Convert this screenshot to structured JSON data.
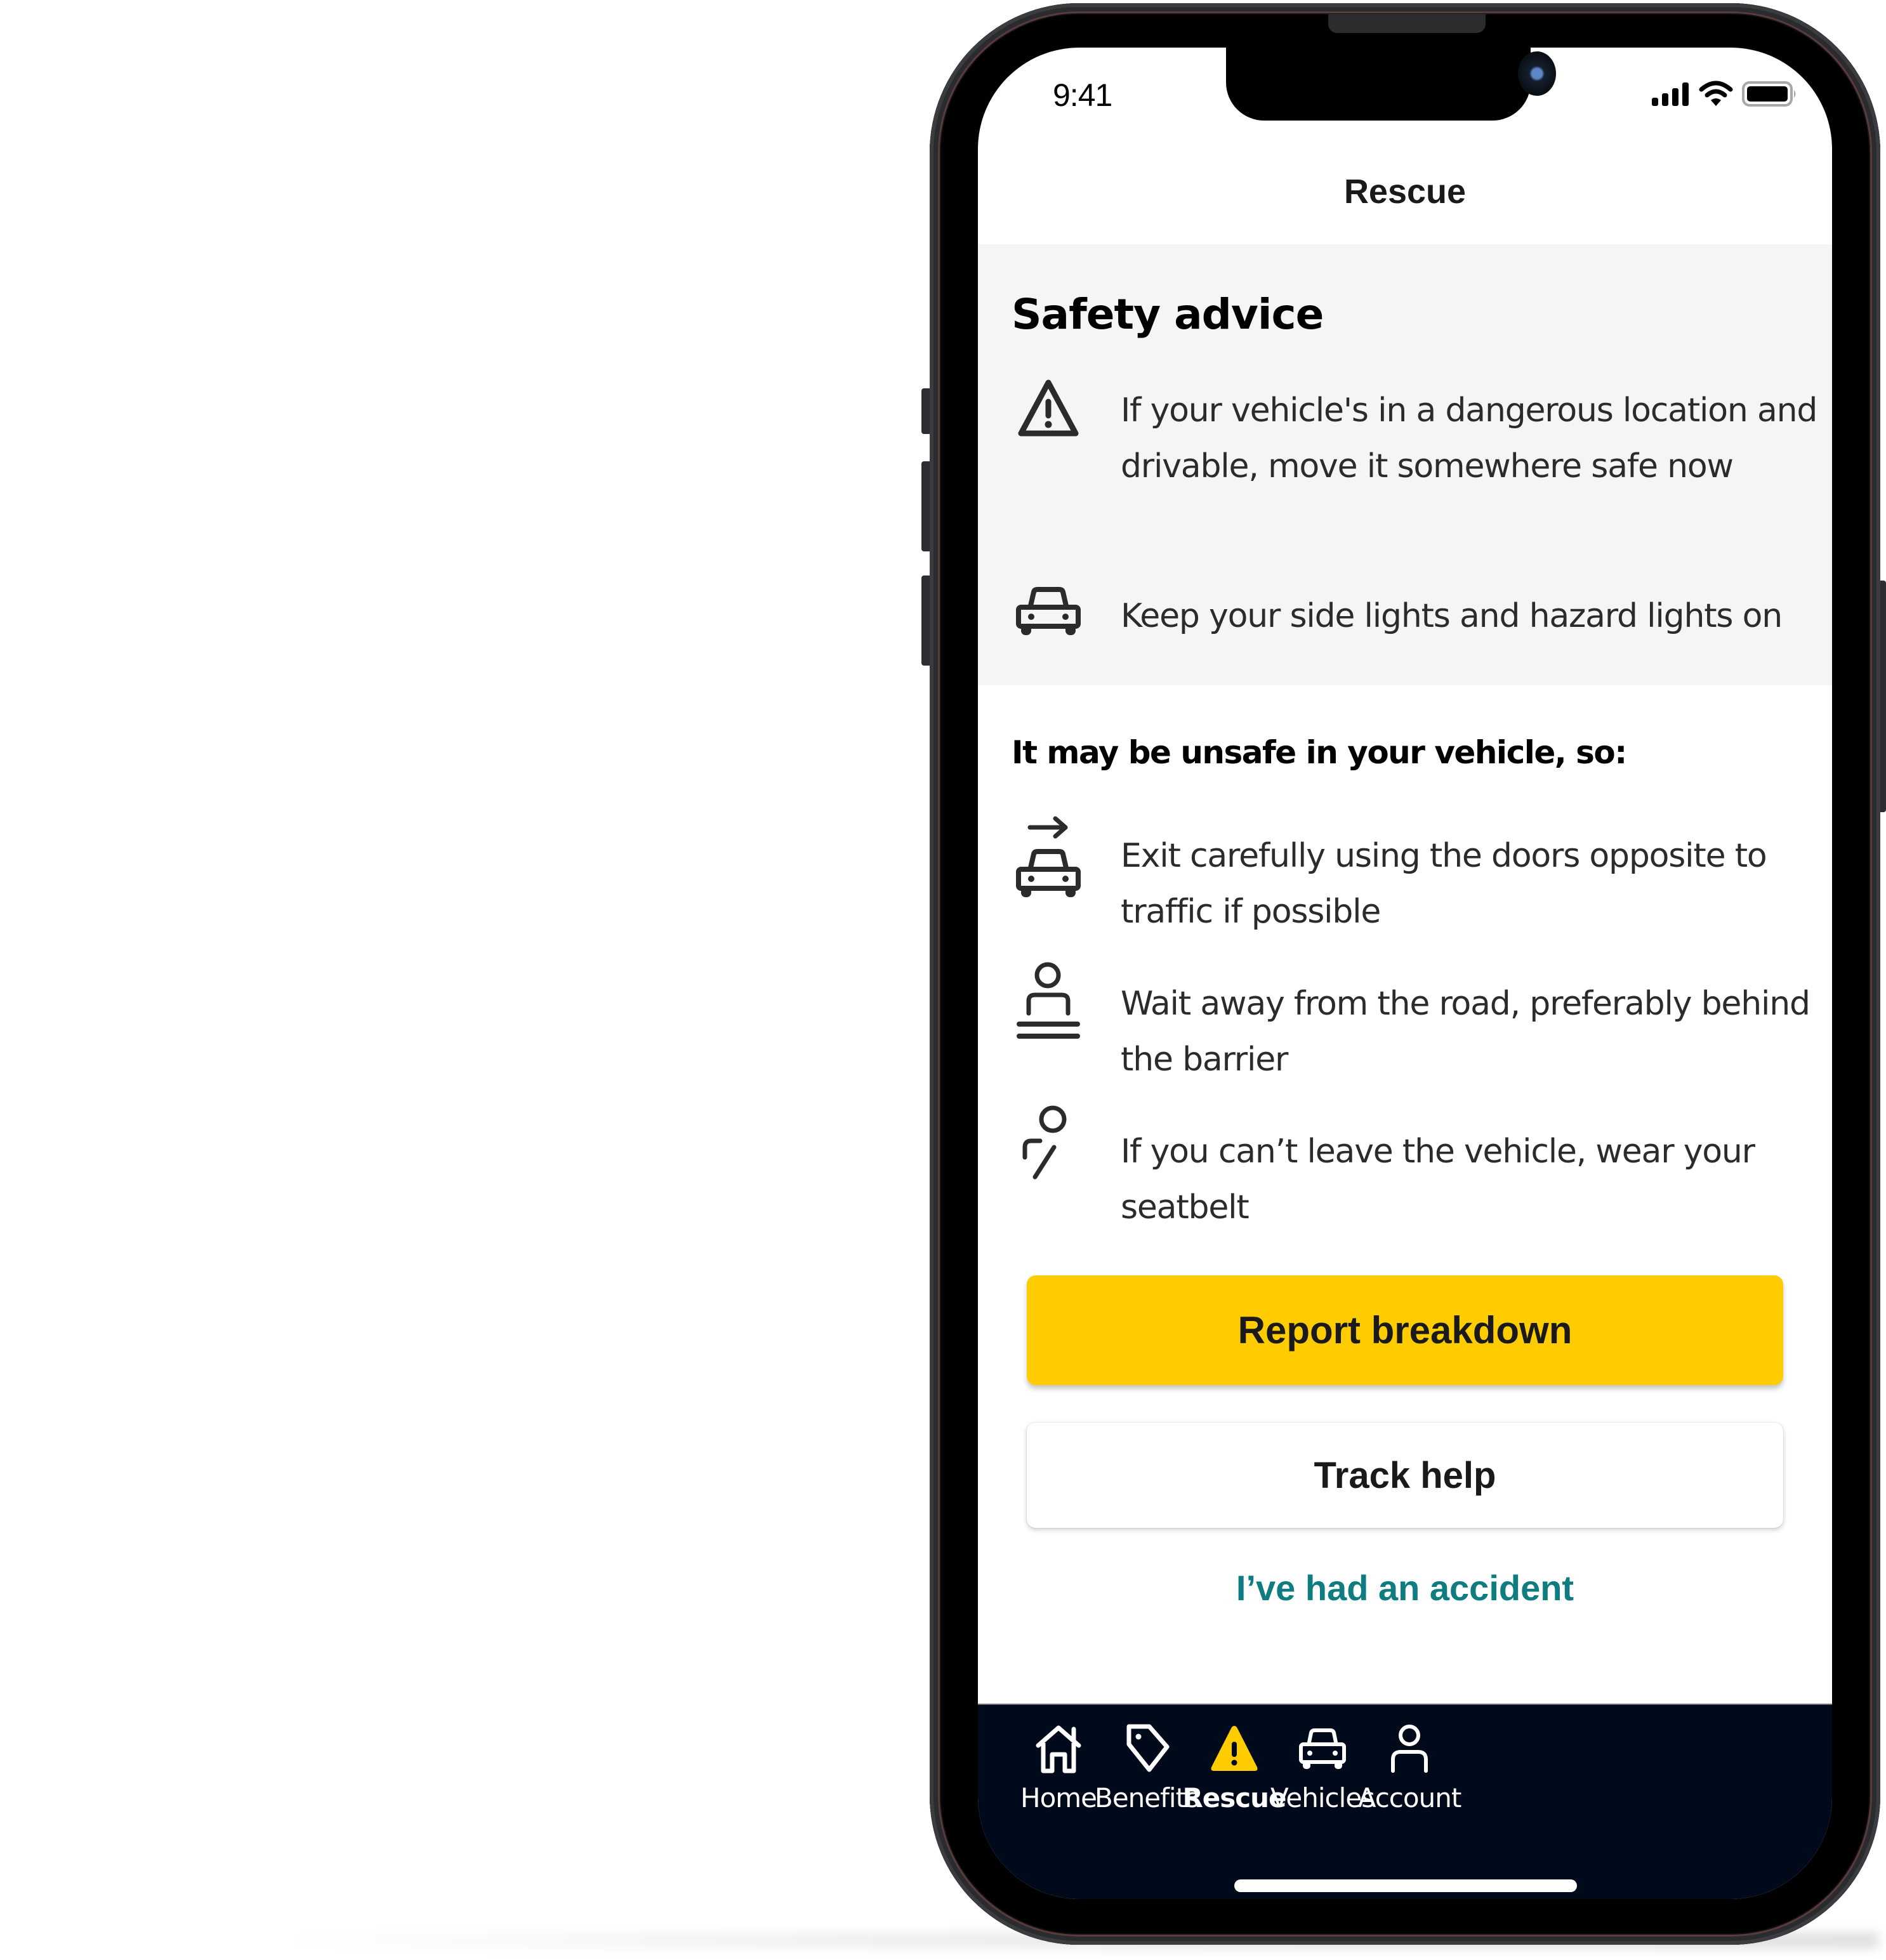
{
  "status_bar": {
    "time": "9:41",
    "icons": [
      "cellular-signal-icon",
      "wifi-icon",
      "battery-icon"
    ]
  },
  "header": {
    "title": "Rescue"
  },
  "safety_advice": {
    "heading": "Safety advice",
    "items": [
      {
        "icon": "warning-triangle-icon",
        "text": "If your vehicle's in a dangerous location and drivable, move it somewhere safe now"
      },
      {
        "icon": "car-icon",
        "text": "Keep your side lights and hazard lights on"
      }
    ]
  },
  "unsafe_section": {
    "heading": "It may be unsafe in your vehicle, so:",
    "items": [
      {
        "icon": "car-exit-icon",
        "text": "Exit carefully using the doors opposite to traffic if possible"
      },
      {
        "icon": "person-behind-barrier-icon",
        "text": "Wait away from the road, preferably behind the barrier"
      },
      {
        "icon": "person-seatbelt-icon",
        "text": "If you can’t leave the vehicle, wear your seatbelt"
      }
    ]
  },
  "actions": {
    "primary_label": "Report breakdown",
    "secondary_label": "Track help",
    "link_label": "I’ve had an accident"
  },
  "bottom_nav": {
    "items": [
      {
        "label": "Home",
        "icon": "home-icon",
        "active": false
      },
      {
        "label": "Benefits",
        "icon": "tag-icon",
        "active": false
      },
      {
        "label": "Rescue",
        "icon": "warning-triangle-icon",
        "active": true
      },
      {
        "label": "Vehicles",
        "icon": "car-icon",
        "active": false
      },
      {
        "label": "Account",
        "icon": "person-icon",
        "active": false
      }
    ]
  },
  "colors": {
    "primary_button": "#ffcc00",
    "link": "#0e7c80",
    "nav_background": "#010a1a",
    "active_nav_icon": "#ffcc00",
    "panel_background": "#f5f5f5"
  }
}
